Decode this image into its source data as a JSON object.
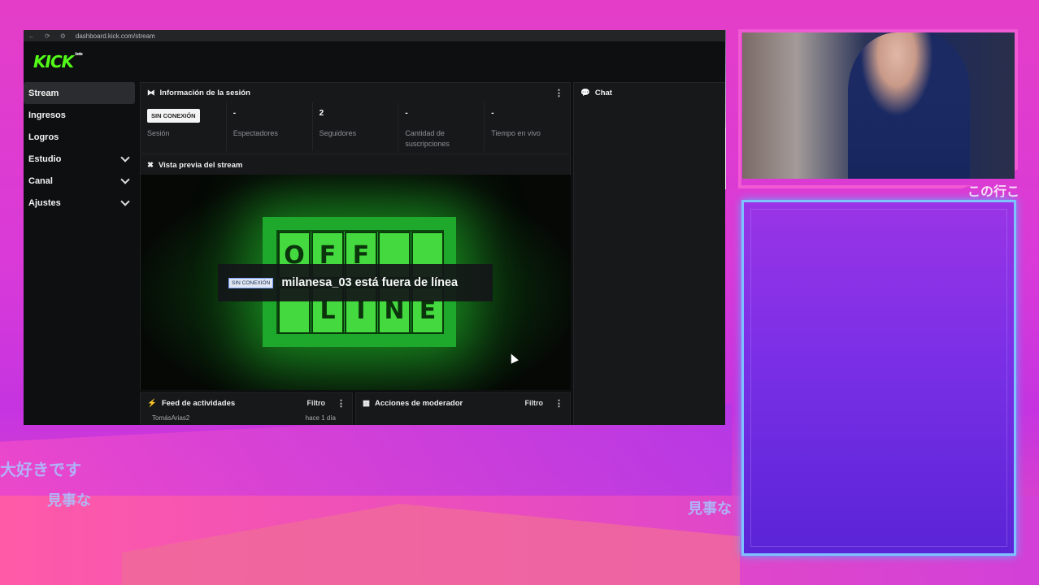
{
  "browser": {
    "url": "dashboard.kick.com/stream"
  },
  "logo": {
    "text": "KICK",
    "tag": "beta"
  },
  "sidebar": {
    "items": [
      {
        "label": "Stream",
        "active": true,
        "expandable": false
      },
      {
        "label": "Ingresos",
        "active": false,
        "expandable": false
      },
      {
        "label": "Logros",
        "active": false,
        "expandable": false
      },
      {
        "label": "Estudio",
        "active": false,
        "expandable": true
      },
      {
        "label": "Canal",
        "active": false,
        "expandable": true
      },
      {
        "label": "Ajustes",
        "active": false,
        "expandable": true
      }
    ]
  },
  "session": {
    "title": "Información de la sesión",
    "stats": [
      {
        "value": "SIN CONEXIÓN",
        "label": "Sesión"
      },
      {
        "value": "-",
        "label": "Espectadores"
      },
      {
        "value": "2",
        "label": "Seguidores"
      },
      {
        "value": "-",
        "label": "Cantidad de suscripciones"
      },
      {
        "value": "-",
        "label": "Tiempo en vivo"
      }
    ]
  },
  "chat": {
    "title": "Chat"
  },
  "preview": {
    "title": "Vista previa del stream",
    "offline_letters_top": [
      "O",
      "F",
      "F",
      ""
    ],
    "offline_letters_bottom": [
      "",
      "L",
      "I",
      "N",
      "E"
    ],
    "badge": "SIN CONEXIÓN",
    "message": "milanesa_03 está fuera de línea"
  },
  "feed": {
    "title": "Feed de actividades",
    "filter": "Filtro",
    "row_user": "TomásArias2",
    "row_meta": "hace 1 día"
  },
  "moderator": {
    "title": "Acciones de moderador",
    "filter": "Filtro"
  },
  "overlay_text": {
    "jp1": "大好きです",
    "jp2": "見事な",
    "jp3": "見事な",
    "jp4": "この行こ"
  },
  "colors": {
    "kick_green": "#53fc18",
    "overlay_pink": "#e43ec8",
    "chat_box_purple": "#7a2fe6",
    "chat_box_border": "#7ec2ff"
  }
}
